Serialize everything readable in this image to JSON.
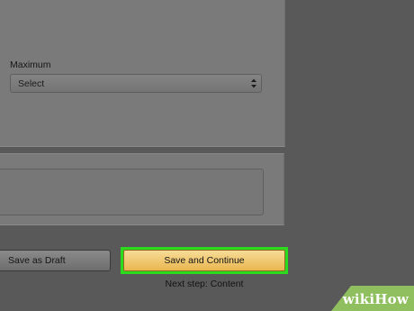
{
  "form": {
    "maximum_label": "Maximum",
    "maximum_select": {
      "selected_value": "Select"
    }
  },
  "actions": {
    "save_draft_label": "Save as Draft",
    "save_continue_label": "Save and Continue",
    "next_step_text": "Next step: Content"
  },
  "watermark": {
    "text": "wikiHow"
  },
  "colors": {
    "highlight": "#2bdc1e",
    "primary_button": "#efc76e",
    "overlay": "#595959"
  }
}
